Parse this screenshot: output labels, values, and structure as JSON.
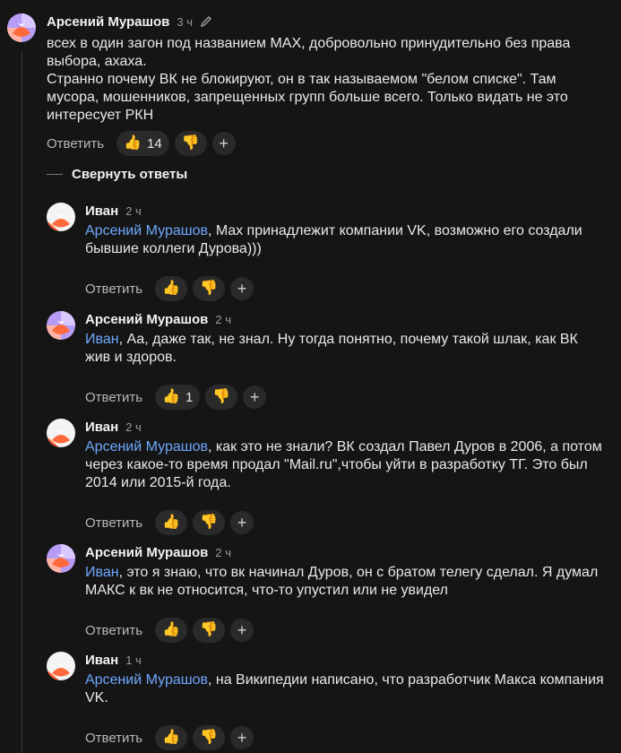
{
  "root": {
    "author": "Арсений Мурашов",
    "time": "3 ч",
    "text": "всех в один загон под названием MAX, добровольно принудительно без права выбора, ахаха.\nСтранно почему ВК не блокируют, он в так называемом \"белом списке\". Там мусора, мошенников, запрещенных групп больше всего. Только видать не это интересует РКН",
    "reply_label": "Ответить",
    "likes": "14"
  },
  "collapse_label": "Свернуть ответы",
  "replies": [
    {
      "author": "Иван",
      "time": "2 ч",
      "mention": "Арсений Мурашов",
      "text": ", Max принадлежит компании VK, возможно его создали бывшие коллеги Дурова)))",
      "reply_label": "Ответить",
      "likes": ""
    },
    {
      "author": "Арсений Мурашов",
      "time": "2 ч",
      "mention": "Иван",
      "text": ", Аа, даже так, не знал. Ну тогда понятно, почему такой шлак, как ВК жив и здоров.",
      "reply_label": "Ответить",
      "likes": "1"
    },
    {
      "author": "Иван",
      "time": "2 ч",
      "mention": "Арсений Мурашов",
      "text": ", как это не знали? ВК создал Павел Дуров в 2006, а потом через какое-то время продал \"Mail.ru\",чтобы уйти в разработку ТГ. Это был 2014 или 2015-й года.",
      "reply_label": "Ответить",
      "likes": ""
    },
    {
      "author": "Арсений Мурашов",
      "time": "2 ч",
      "mention": "Иван",
      "text": ", это я знаю, что вк начинал Дуров, он с братом телегу сделал. Я думал МАКС к вк не относится, что-то упустил или не увидел",
      "reply_label": "Ответить",
      "likes": ""
    },
    {
      "author": "Иван",
      "time": "1 ч",
      "mention": "Арсений Мурашов",
      "text": ", на Википедии написано, что разработчик Макса компания VK.",
      "reply_label": "Ответить",
      "likes": ""
    }
  ],
  "icons": {
    "like": "👍",
    "dislike": "👎",
    "add": "+"
  },
  "colors": {
    "mention": "#6fa8ff",
    "background": "#151515",
    "reaction_bg": "#2a2a2a"
  }
}
